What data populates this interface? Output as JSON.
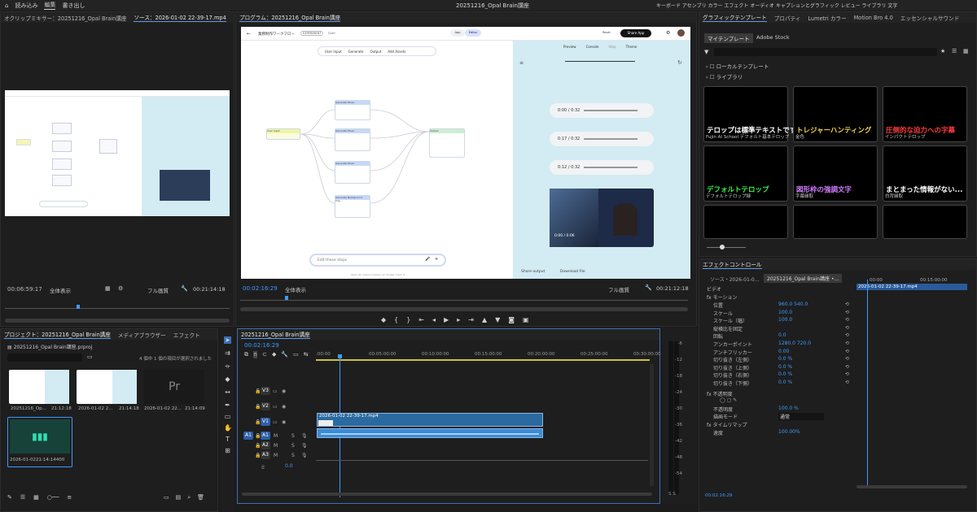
{
  "topbar": {
    "tabs": [
      "読み込み",
      "編集",
      "書き出し"
    ],
    "active_tab": "編集",
    "project_title": "20251216_Opal Brain講座",
    "menus": "キーボード アセンブリ カラー エフェクト オーディオ キャプションとグラフィック レビュー ライブラリ 文字"
  },
  "source": {
    "tabs": [
      "オクリップミキサー：20251216_Opal Brain講座",
      "ソース：2026-01-02 22-39-17.mp4",
      "デイ"
    ],
    "timecode": "00:06:59:17",
    "zoom": "全体表示",
    "quality": "フル画質",
    "duration": "00:21:14:18"
  },
  "program": {
    "tab": "プログラム：20251216_Opal Brain講座",
    "timecode": "00:02:16:29",
    "zoom": "全体表示",
    "quality": "フル画質",
    "duration": "00:21:12:18"
  },
  "opal": {
    "title": "業務制作ワークフロー",
    "badge": "EXPERIMENT",
    "status": "Draft",
    "app_tab": "App",
    "editor_tab": "Editor",
    "reset": "Reset",
    "share": "Share App",
    "tools": [
      "User Input",
      "Generate",
      "Output",
      "Add Assets"
    ],
    "preview_tabs": [
      "Preview",
      "Console",
      "Step",
      "Theme"
    ],
    "edit_placeholder": "Edit these steps",
    "footer": "Opal can make mistakes, so double check it",
    "share_output": "Share output",
    "download": "Download file",
    "audio": [
      "0:00 / 0:32",
      "0:17 / 0:32",
      "0:12 / 0:32"
    ],
    "video_time": "0:00 / 0:06",
    "nodes": [
      "User Input",
      "Generate Music",
      "Generate Music",
      "Generate Music",
      "Generate Background Ima...",
      "Output"
    ]
  },
  "graphics": {
    "tabs": [
      "グラフィックテンプレート",
      "プロパティ",
      "Lumetri カラー",
      "Motion Bro 4.0",
      "エッセンシャルサウンド"
    ],
    "subtabs": [
      "マイテンプレート",
      "Adobe Stock"
    ],
    "tree": [
      "ローカルテンプレート",
      "ライブラリ"
    ],
    "templates": [
      {
        "text": "テロップは標準テキストです。",
        "cap": "Fujin AI School デフォルト基本テロップ"
      },
      {
        "text": "トレジャーハンティング",
        "cap": "金色"
      },
      {
        "text": "圧倒的な迫力への字幕",
        "cap": "インパクトテロップ"
      },
      {
        "text": "デフォルトテロップ",
        "cap": "デフォルトテロップ緑"
      },
      {
        "text": "図形枠の強調文字",
        "cap": "字幕縁取"
      },
      {
        "text": "まとまった情報がない...",
        "cap": "白背縁取"
      }
    ]
  },
  "effects": {
    "tab": "エフェクトコントロール",
    "source": "ソース・2026-01-0...",
    "seq": "20251216_Opal Brain講座 •...",
    "ruler": [
      "00:00",
      "00:15:00:00"
    ],
    "clip": "2026-01-02 22-39-17.mp4",
    "video_label": "ビデオ",
    "motion": "モーション",
    "props": [
      {
        "name": "位置",
        "value": "960.0    540.0"
      },
      {
        "name": "スケール",
        "value": "100.0"
      },
      {
        "name": "スケール（幅）",
        "value": "100.0"
      },
      {
        "name": "縦横比を固定",
        "value": ""
      },
      {
        "name": "回転",
        "value": "0.0"
      },
      {
        "name": "アンカーポイント",
        "value": "1280.0    720.0"
      },
      {
        "name": "アンチフリッカー",
        "value": "0.00"
      },
      {
        "name": "切り抜き（左側）",
        "value": "0.0 %"
      },
      {
        "name": "切り抜き（上側）",
        "value": "0.0 %"
      },
      {
        "name": "切り抜き（右側）",
        "value": "0.0 %"
      },
      {
        "name": "切り抜き（下側）",
        "value": "0.0 %"
      }
    ],
    "opacity": "不透明度",
    "opacity_value": "100.0 %",
    "blend": "描画モード",
    "blend_value": "通常",
    "time_remap": "タイムリマップ",
    "speed": "速度",
    "speed_value": "100.00%",
    "footer_time": "00:02:16:29"
  },
  "project": {
    "tabs": [
      "プロジェクト：20251216_Opal Brain講座",
      "メディアブラウザー",
      "エフェクト"
    ],
    "file": "20251216_Opal Brain講座.prproj",
    "count": "4 個中 1 個の項目が選択されました",
    "items": [
      {
        "name": "20251216_Op...",
        "dur": "21:12:18"
      },
      {
        "name": "2026-01-02 2...",
        "dur": "21:14:18"
      },
      {
        "name": "2026-01-02 22...",
        "dur": "21:14:09"
      },
      {
        "name": "2026-01-02...",
        "dur": "21:14:14400"
      }
    ]
  },
  "timeline": {
    "tab": "20251216_Opal Brain講座",
    "timecode": "00:02:16:29",
    "ruler": [
      ":00:00",
      "00:05:00:00",
      "00:10:00:00",
      "00:15:00:00",
      "00:20:00:00",
      "00:25:00:00",
      "00:30:00:00"
    ],
    "tracks": [
      "V3",
      "V2",
      "V1",
      "A1",
      "A2",
      "A3"
    ],
    "clip": "2026-01-02 22-39-17.mp4",
    "master": "ミ",
    "master_val": "0.0",
    "levels": [
      "-6",
      "-12",
      "-18",
      "-24",
      "-30",
      "-36",
      "-42",
      "-48",
      "-54"
    ],
    "level_foot": "S S"
  }
}
